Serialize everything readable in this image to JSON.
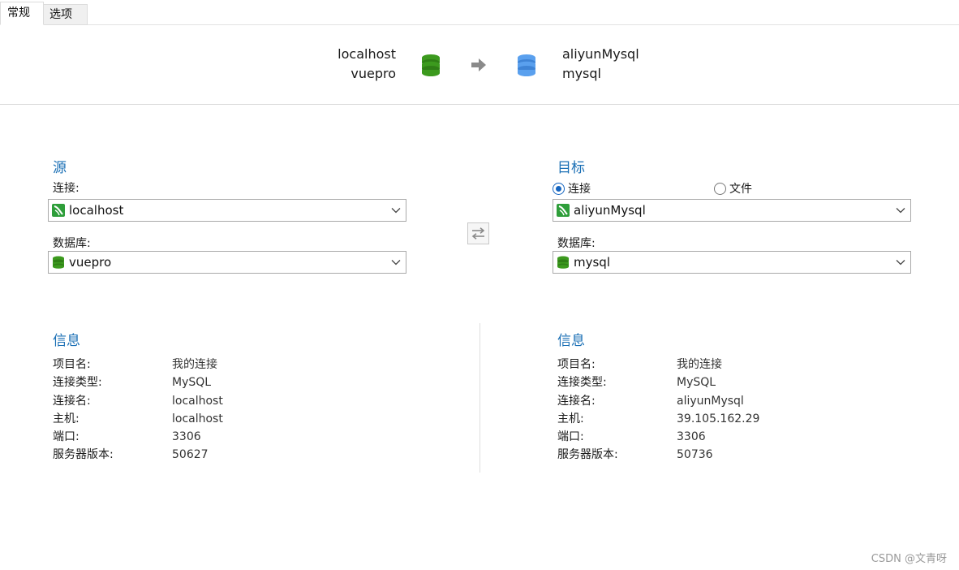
{
  "tabs": {
    "general": "常规",
    "options": "选项"
  },
  "header": {
    "source_connection": "localhost",
    "source_database": "vuepro",
    "target_connection": "aliyunMysql",
    "target_database": "mysql"
  },
  "source": {
    "title": "源",
    "connection_label": "连接:",
    "connection_value": "localhost",
    "database_label": "数据库:",
    "database_value": "vuepro"
  },
  "target": {
    "title": "目标",
    "radio_connection": "连接",
    "radio_file": "文件",
    "selected_mode": "连接",
    "connection_value": "aliyunMysql",
    "database_label": "数据库:",
    "database_value": "mysql"
  },
  "source_info": {
    "title": "信息",
    "rows": [
      {
        "key": "项目名:",
        "value": "我的连接"
      },
      {
        "key": "连接类型:",
        "value": "MySQL"
      },
      {
        "key": "连接名:",
        "value": "localhost"
      },
      {
        "key": "主机:",
        "value": "localhost"
      },
      {
        "key": "端口:",
        "value": "3306"
      },
      {
        "key": "服务器版本:",
        "value": "50627"
      }
    ]
  },
  "target_info": {
    "title": "信息",
    "rows": [
      {
        "key": "项目名:",
        "value": "我的连接"
      },
      {
        "key": "连接类型:",
        "value": "MySQL"
      },
      {
        "key": "连接名:",
        "value": "aliyunMysql"
      },
      {
        "key": "主机:",
        "value": "39.105.162.29"
      },
      {
        "key": "端口:",
        "value": "3306"
      },
      {
        "key": "服务器版本:",
        "value": "50736"
      }
    ]
  },
  "watermark": "CSDN @文青呀",
  "colors": {
    "accent": "#1a6fb5",
    "source_db": "#3c9a1e",
    "target_db": "#4a90e2",
    "mysql_icon": "#2e9e3a"
  },
  "icons": {
    "source_db": "database-icon",
    "target_db": "database-icon",
    "arrow": "arrow-right-icon",
    "swap": "swap-icon",
    "mysql": "mysql-connection-icon",
    "chevron": "chevron-down-icon"
  }
}
